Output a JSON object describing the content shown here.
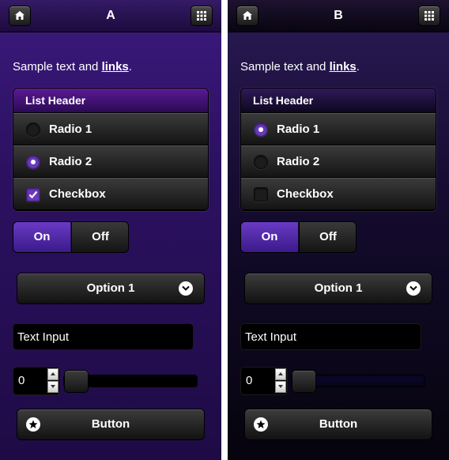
{
  "panels": [
    {
      "title": "A",
      "header_left_icon": "home-icon",
      "header_right_icon": "grid-icon",
      "sample_text": "Sample text and ",
      "sample_link": "links",
      "sample_end": ".",
      "list_header": "List Header",
      "rows": [
        {
          "type": "radio",
          "label": "Radio 1",
          "checked": false
        },
        {
          "type": "radio",
          "label": "Radio 2",
          "checked": true
        },
        {
          "type": "checkbox",
          "label": "Checkbox",
          "checked": true
        }
      ],
      "toggle": {
        "on_label": "On",
        "off_label": "Off",
        "selected": "On"
      },
      "select": {
        "value": "Option 1",
        "icon": "chevron-down-icon"
      },
      "text_input": {
        "value": "Text Input"
      },
      "number_input": {
        "value": "0"
      },
      "slider": {
        "value": 0
      },
      "button": {
        "label": "Button",
        "icon": "star-icon"
      }
    },
    {
      "title": "B",
      "header_left_icon": "home-icon",
      "header_right_icon": "grid-icon",
      "sample_text": "Sample text and ",
      "sample_link": "links",
      "sample_end": ".",
      "list_header": "List Header",
      "rows": [
        {
          "type": "radio",
          "label": "Radio 1",
          "checked": true
        },
        {
          "type": "radio",
          "label": "Radio 2",
          "checked": false
        },
        {
          "type": "checkbox",
          "label": "Checkbox",
          "checked": false
        }
      ],
      "toggle": {
        "on_label": "On",
        "off_label": "Off",
        "selected": "On"
      },
      "select": {
        "value": "Option 1",
        "icon": "chevron-down-icon"
      },
      "text_input": {
        "value": "Text Input"
      },
      "number_input": {
        "value": "0"
      },
      "slider": {
        "value": 0
      },
      "button": {
        "label": "Button",
        "icon": "star-icon"
      }
    }
  ],
  "colors": {
    "accent": "#6a3ab8",
    "theme_a_background": "#2d1163",
    "theme_b_background": "#140b2e"
  }
}
